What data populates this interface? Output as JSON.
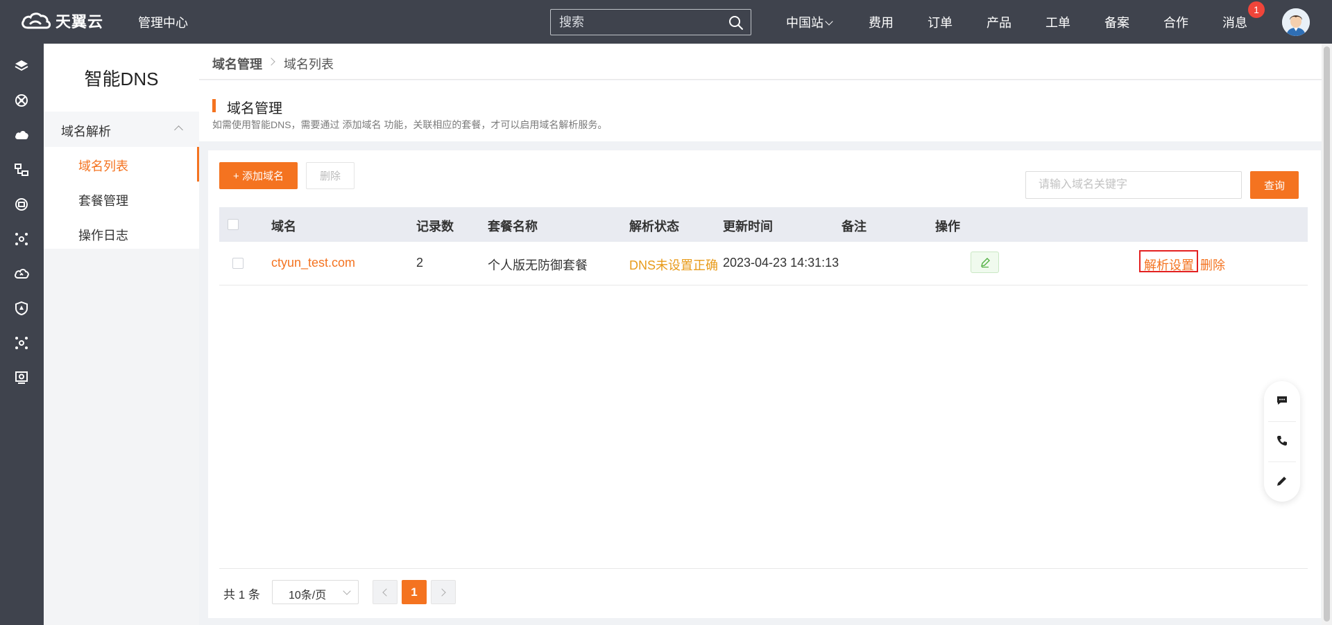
{
  "brand": {
    "name": "天翼云",
    "mgmt_center": "管理中心"
  },
  "search": {
    "placeholder": "搜索"
  },
  "topnav": {
    "region": "中国站",
    "items": [
      "费用",
      "订单",
      "产品",
      "工单",
      "备案",
      "合作",
      "消息"
    ],
    "message_badge": "1"
  },
  "sidebar": {
    "title": "智能DNS",
    "group": "域名解析",
    "items": [
      {
        "label": "域名列表",
        "active": true
      },
      {
        "label": "套餐管理",
        "active": false
      },
      {
        "label": "操作日志",
        "active": false
      }
    ]
  },
  "breadcrumb": {
    "parent": "域名管理",
    "current": "域名列表"
  },
  "header": {
    "title": "域名管理",
    "description": "如需使用智能DNS，需要通过 添加域名 功能，关联相应的套餐，才可以启用域名解析服务。"
  },
  "toolbar": {
    "add_label": "+ 添加域名",
    "delete_label": "删除",
    "keyword_placeholder": "请输入域名关键字",
    "query_label": "查询"
  },
  "table": {
    "columns": [
      "域名",
      "记录数",
      "套餐名称",
      "解析状态",
      "更新时间",
      "备注",
      "操作"
    ],
    "rows": [
      {
        "domain": "ctyun_test.com",
        "records": "2",
        "package": "个人版无防御套餐",
        "status": "DNS未设置正确",
        "updated": "2023-04-23 14:31:13",
        "op_setting": "解析设置",
        "op_delete": "删除"
      }
    ]
  },
  "pagination": {
    "total": "共 1 条",
    "page_size": "10条/页",
    "current_page": "1"
  },
  "colors": {
    "accent": "#f47320",
    "topbar": "#3f434d",
    "warning": "#e89b1a",
    "highlight": "#e32020"
  }
}
